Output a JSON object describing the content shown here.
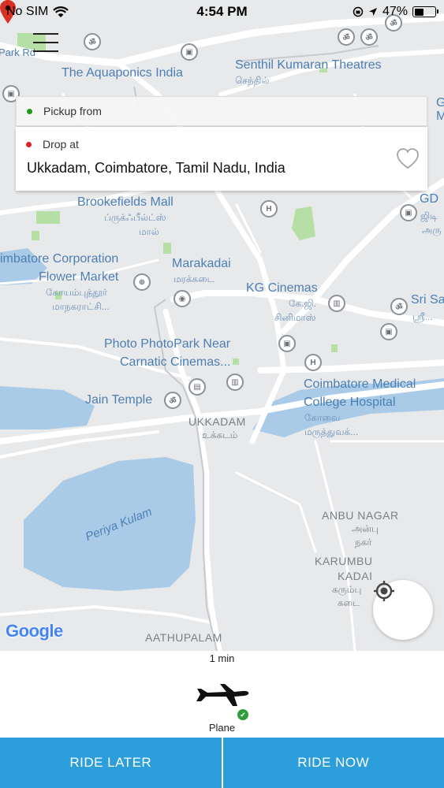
{
  "status_bar": {
    "carrier": "No SIM",
    "time": "4:54 PM",
    "battery": "47%",
    "battery_fraction": 0.47
  },
  "map": {
    "labels": {
      "park_rd": "Park Rd",
      "aquaponics": "The Aquaponics India",
      "senthil": "Senthil Kumaran Theatres",
      "senthil_ta": "செந்தில்",
      "brookefields": "Brookefields Mall",
      "brookefields_ta1": "ப்ருக்ஃபீல்ட்ஸ்",
      "brookefields_ta2": "மால்",
      "gd": "GD",
      "gd_ta1": "ஜிடி",
      "gd_ta2": "அரு",
      "g_partial": "G",
      "m_partial": "M",
      "corporation": "imbatore Corporation",
      "flower_market": "Flower Market",
      "flower_ta1": "கோயம்புத்தூர்",
      "flower_ta2": "மாநகராட்சி...",
      "marakadai": "Marakadai",
      "marakadai_ta": "மரக்கடை",
      "kg_cinemas": "KG Cinemas",
      "kg_ta1": "கே.ஜி.",
      "kg_ta2": "சினிமாஸ்",
      "sri_s": "Sri Sa",
      "sri_ta": "ஸ்ரீ...",
      "photo_park1": "Photo PhotoPark Near",
      "photo_park2": "Carnatic Cinemas...",
      "jain_temple": "Jain Temple",
      "ukkadam": "UKKADAM",
      "ukkadam_ta": "உக்கடம்",
      "medical1": "Coimbatore Medical",
      "medical2": "College Hospital",
      "medical_ta1": "கோவை",
      "medical_ta2": "மருத்துவக்...",
      "periya_kulam": "Periya Kulam",
      "anbu_nagar": "ANBU NAGAR",
      "anbu_ta1": "அன்பு",
      "anbu_ta2": "நகர்",
      "karumbu": "KARUMBU",
      "kadai": "KADAI",
      "karumbu_ta1": "கரும்பு",
      "karumbu_ta2": "கடை",
      "aathupalam": "AATHUPALAM",
      "google": "Google"
    }
  },
  "location": {
    "pickup_label": "Pickup from",
    "drop_label": "Drop at",
    "drop_address": "Ukkadam, Coimbatore, Tamil Nadu, India"
  },
  "vehicle": {
    "eta": "1 min",
    "name": "Plane"
  },
  "actions": {
    "ride_later": "RIDE LATER",
    "ride_now": "RIDE NOW"
  },
  "colors": {
    "accent": "#2c9edb",
    "pickup_dot": "#1a9a1a",
    "drop_dot": "#e02020",
    "marker": "#d93025",
    "check": "#2e9e3a"
  }
}
